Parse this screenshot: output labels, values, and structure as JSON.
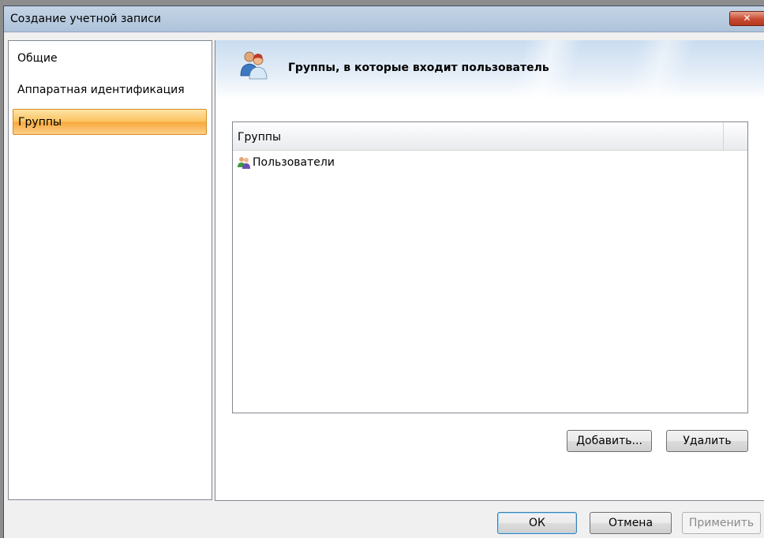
{
  "window": {
    "title": "Создание учетной записи",
    "close_symbol": "✕"
  },
  "sidebar": {
    "items": [
      {
        "label": "Общие",
        "active": false
      },
      {
        "label": "Аппаратная идентификация",
        "active": false
      },
      {
        "label": "Группы",
        "active": true
      }
    ]
  },
  "banner": {
    "icon": "users-icon",
    "title": "Группы, в которые входит пользователь"
  },
  "groups_list": {
    "column_header": "Группы",
    "rows": [
      {
        "icon": "group-icon",
        "label": "Пользователи"
      }
    ]
  },
  "list_buttons": {
    "add": "Добавить...",
    "remove": "Удалить"
  },
  "dialog_buttons": {
    "ok": "ОК",
    "cancel": "Отмена",
    "apply": "Применить"
  },
  "colors": {
    "active_nav": "#fbc25e",
    "title_bar": "#b9cde3",
    "close_button": "#c74a30"
  }
}
